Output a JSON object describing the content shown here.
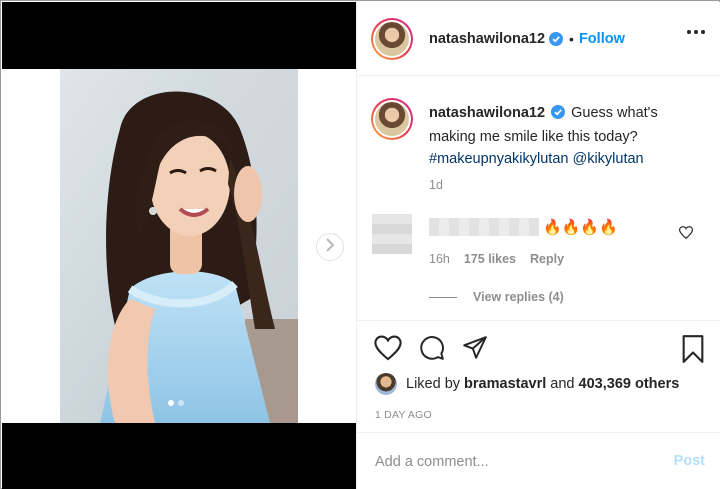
{
  "post": {
    "username": "natashawilona12",
    "follow_label": "Follow",
    "separator": "•"
  },
  "caption": {
    "username": "natashawilona12",
    "text": "Guess what's making me smile like this today?",
    "hashtag": "#makeupnyakikylutan",
    "mention": "@kikylutan",
    "time": "1d"
  },
  "comment": {
    "emoji": "🔥🔥🔥🔥",
    "time": "16h",
    "likes": "175 likes",
    "reply_label": "Reply",
    "view_replies": "View replies (4)"
  },
  "likes": {
    "prefix": "Liked by",
    "user": "bramastavrl",
    "middle": "and",
    "others": "403,369 others"
  },
  "post_time": "1 DAY AGO",
  "add_comment": {
    "placeholder": "Add a comment...",
    "post_label": "Post"
  },
  "carousel": {
    "total_slides": 2,
    "active_slide": 1
  },
  "colors": {
    "accent": "#0095f6",
    "hashtag": "#00376b",
    "muted": "#8e8e8e",
    "post_disabled": "#b2dffc",
    "photo_dress": "#a9d4ee"
  },
  "icons": [
    "verified-badge-icon",
    "more-options-icon",
    "next-arrow-icon",
    "heart-icon",
    "comment-icon",
    "share-icon",
    "bookmark-icon",
    "fire-emoji"
  ]
}
